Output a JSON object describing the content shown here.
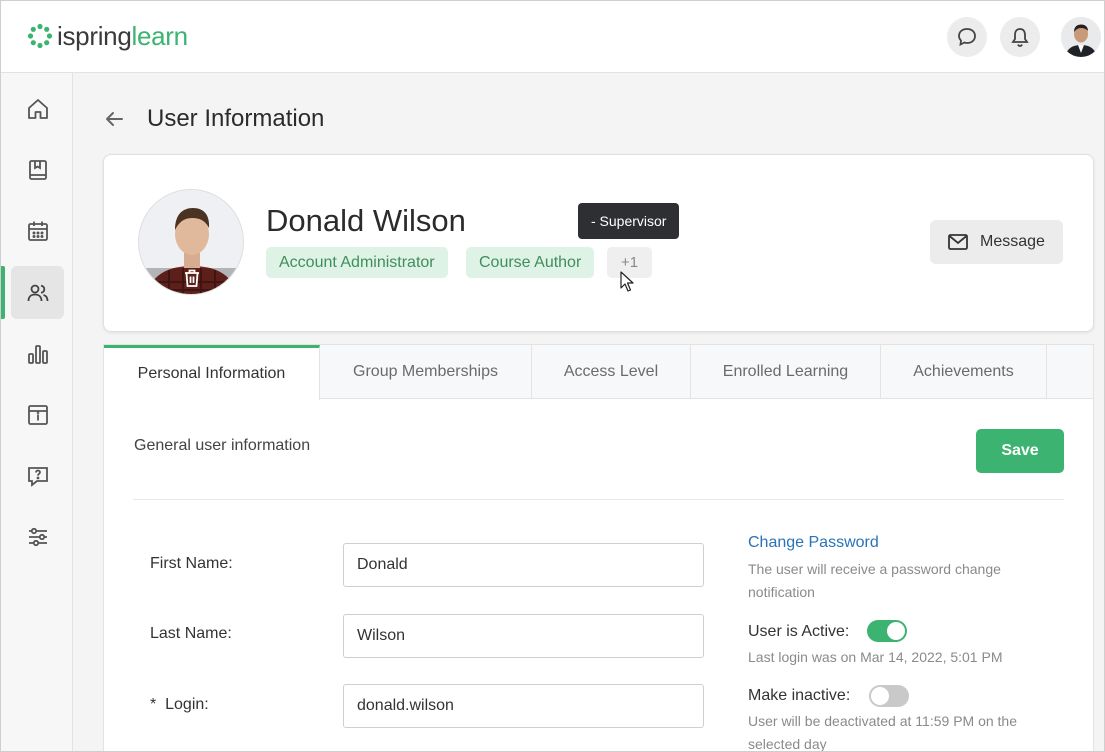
{
  "brand": {
    "name_part1": "ispring",
    "name_part2": "learn",
    "accent": "#3cb371"
  },
  "header": {
    "icons": [
      "chat-icon",
      "bell-icon",
      "user-avatar"
    ]
  },
  "sidebar": {
    "items": [
      {
        "icon": "home-icon",
        "active": false
      },
      {
        "icon": "book-icon",
        "active": false
      },
      {
        "icon": "calendar-icon",
        "active": false
      },
      {
        "icon": "users-icon",
        "active": true
      },
      {
        "icon": "bar-chart-icon",
        "active": false
      },
      {
        "icon": "info-icon",
        "active": false
      },
      {
        "icon": "question-icon",
        "active": false
      },
      {
        "icon": "settings-sliders-icon",
        "active": false
      }
    ]
  },
  "page": {
    "title": "User Information"
  },
  "profile": {
    "name": "Donald Wilson",
    "roles": [
      "Account Administrator",
      "Course Author"
    ],
    "more_roles": "+1",
    "tooltip": "- Supervisor",
    "message_label": "Message"
  },
  "tabs": [
    "Personal Information",
    "Group Memberships",
    "Access Level",
    "Enrolled Learning",
    "Achievements"
  ],
  "form": {
    "section_title": "General user information",
    "save_label": "Save",
    "first_name_label": "First Name:",
    "first_name": "Donald",
    "last_name_label": "Last Name:",
    "last_name": "Wilson",
    "login_label": "*  Login:",
    "login": "donald.wilson",
    "change_password": "Change Password",
    "change_password_hint": "The user will receive a password change notification",
    "active_label": "User is Active:",
    "active": true,
    "last_login": "Last login was on Mar 14, 2022, 5:01 PM",
    "inactive_label": "Make inactive:",
    "inactive": false,
    "inactive_hint": "User will be deactivated at 11:59 PM on the selected day"
  }
}
